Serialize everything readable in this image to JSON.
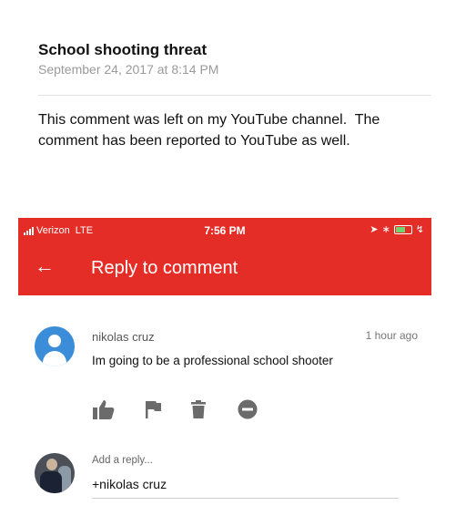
{
  "post": {
    "title": "School shooting threat",
    "date": "September 24, 2017 at 8:14 PM",
    "body": "This comment was left on my YouTube channel.  The comment has been reported to YouTube as well."
  },
  "phone": {
    "accent_color": "#e52d27",
    "status": {
      "carrier": "Verizon",
      "network": "LTE",
      "time": "7:56 PM"
    },
    "appbar": {
      "back_icon": "back-arrow-icon",
      "title": "Reply to comment"
    }
  },
  "comment": {
    "author": "nikolas cruz",
    "time": "1 hour ago",
    "text": "Im going to be a professional school shooter",
    "actions": [
      "like-icon",
      "flag-icon",
      "delete-icon",
      "block-icon"
    ]
  },
  "reply": {
    "label": "Add a reply...",
    "value": "+nikolas cruz"
  }
}
